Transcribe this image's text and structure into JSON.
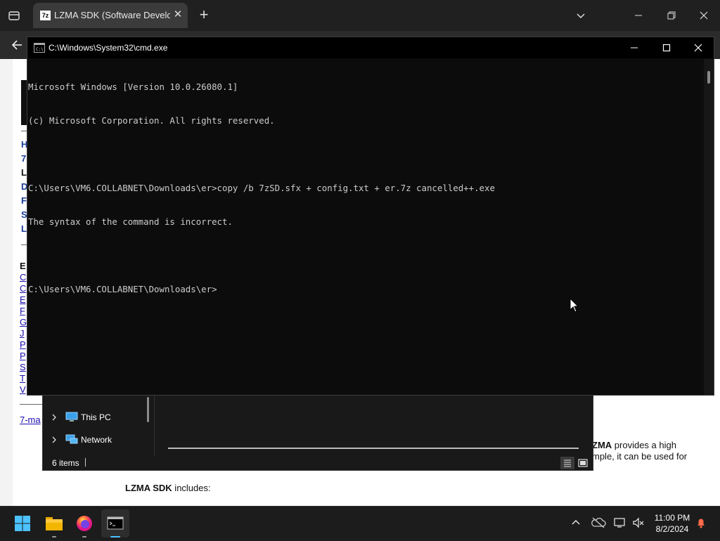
{
  "browser": {
    "tab_title": "LZMA SDK (Software Developm",
    "tab_icon_text": "7z"
  },
  "webpage": {
    "side_letters": [
      "H",
      "7",
      "L",
      "D",
      "F",
      "S",
      "L"
    ],
    "side_heading_letter": "E",
    "side_links": [
      "C",
      "C",
      "E",
      "F",
      "G",
      "J",
      "P",
      "P",
      "S",
      "T",
      "V"
    ],
    "footer_link": "7-ma",
    "body_fragment_bold": "ZMA",
    "body_fragment_1": " provides a high",
    "body_fragment_2": "mple, it can be used for",
    "includes_bold": "LZMA SDK",
    "includes_rest": " includes:"
  },
  "explorer": {
    "nav_items": [
      {
        "label": "This PC",
        "icon": "computer-icon"
      },
      {
        "label": "Network",
        "icon": "network-icon"
      }
    ],
    "status_text": "6 items"
  },
  "cmd": {
    "title": "C:\\Windows\\System32\\cmd.exe",
    "lines": [
      "Microsoft Windows [Version 10.0.26080.1]",
      "(c) Microsoft Corporation. All rights reserved.",
      "",
      "C:\\Users\\VM6.COLLABNET\\Downloads\\er>copy /b 7zSD.sfx + config.txt + er.7z cancelled++.exe",
      "The syntax of the command is incorrect.",
      "",
      "C:\\Users\\VM6.COLLABNET\\Downloads\\er>"
    ]
  },
  "taskbar": {
    "time": "11:00 PM",
    "date": "8/2/2024",
    "apps": [
      "start-icon",
      "file-explorer-icon",
      "firefox-icon",
      "terminal-icon"
    ]
  }
}
